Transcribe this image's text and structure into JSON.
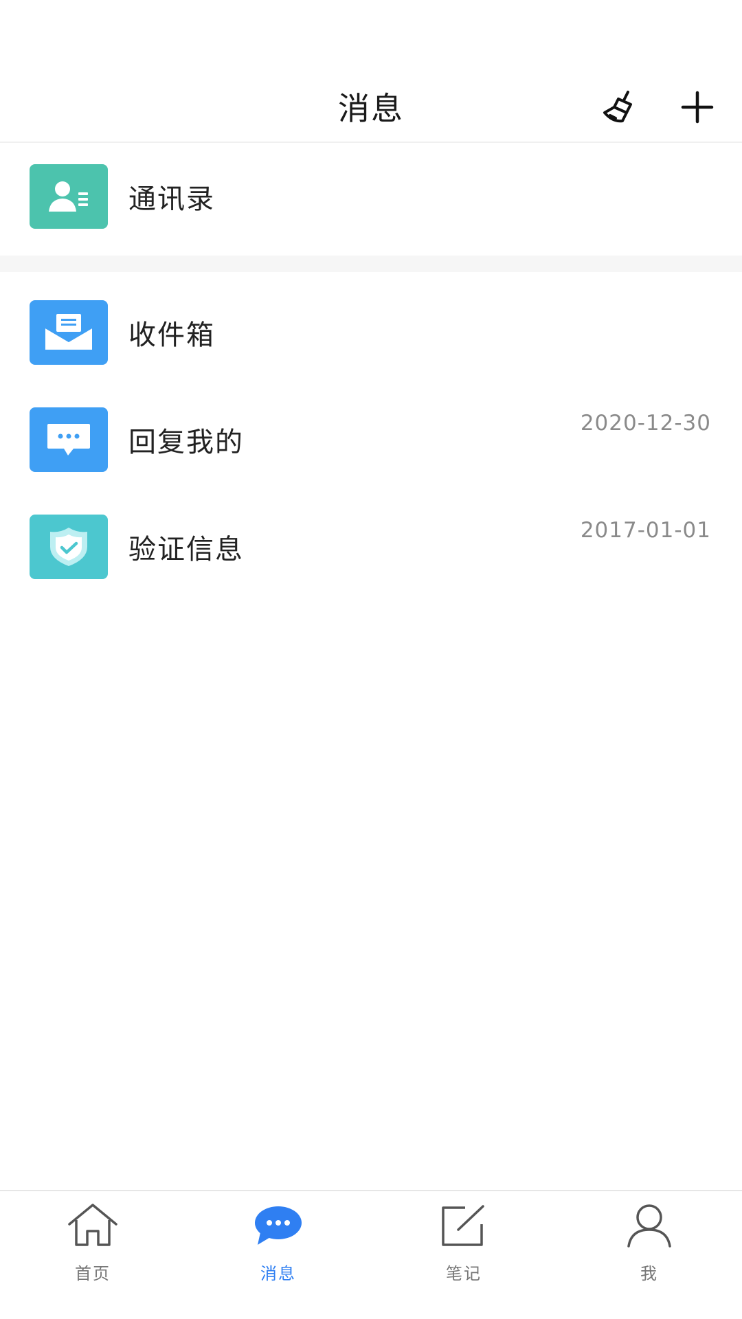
{
  "header": {
    "title": "消息",
    "clear_icon": "broom-icon",
    "add_icon": "plus-icon"
  },
  "items": [
    {
      "label": "通讯录",
      "icon": "contacts-icon",
      "color": "#4cc3ad",
      "date": ""
    },
    {
      "label": "收件箱",
      "icon": "inbox-icon",
      "color": "#3f9ff4",
      "date": ""
    },
    {
      "label": "回复我的",
      "icon": "chat-bubble-icon",
      "color": "#3f9ff4",
      "date": "2020-12-30"
    },
    {
      "label": "验证信息",
      "icon": "shield-check-icon",
      "color": "#4cc7cf",
      "date": "2017-01-01"
    }
  ],
  "tabs": [
    {
      "label": "首页",
      "icon": "home-icon",
      "active": false
    },
    {
      "label": "消息",
      "icon": "message-icon",
      "active": true
    },
    {
      "label": "笔记",
      "icon": "note-edit-icon",
      "active": false
    },
    {
      "label": "我",
      "icon": "user-icon",
      "active": false
    }
  ],
  "colors": {
    "accent": "#2f7ff2",
    "inactive": "#777777",
    "date_text": "#8a8a8a"
  }
}
